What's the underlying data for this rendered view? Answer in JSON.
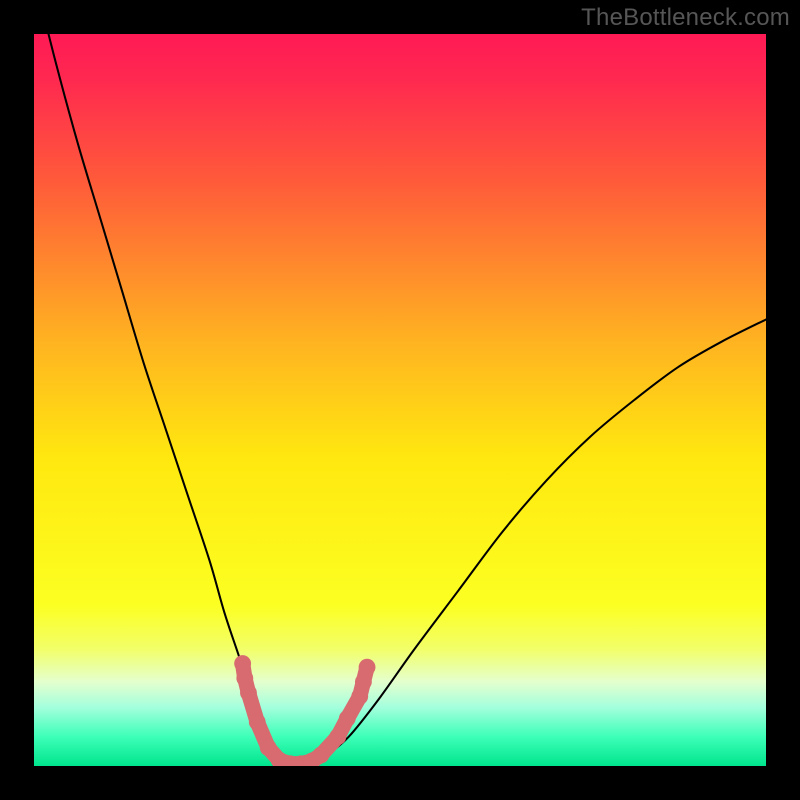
{
  "watermark": {
    "text": "TheBottleneck.com"
  },
  "chart_data": {
    "type": "line",
    "title": "",
    "xlabel": "",
    "ylabel": "",
    "xlim": [
      0,
      100
    ],
    "ylim": [
      0,
      100
    ],
    "background_gradient": {
      "stops": [
        {
          "pos": 0.0,
          "color": "#ff1a55"
        },
        {
          "pos": 0.06,
          "color": "#ff2850"
        },
        {
          "pos": 0.2,
          "color": "#ff5a3a"
        },
        {
          "pos": 0.42,
          "color": "#ffb321"
        },
        {
          "pos": 0.58,
          "color": "#ffe80f"
        },
        {
          "pos": 0.78,
          "color": "#fcff22"
        },
        {
          "pos": 0.84,
          "color": "#f2ff68"
        },
        {
          "pos": 0.885,
          "color": "#e4ffce"
        },
        {
          "pos": 0.92,
          "color": "#a3ffdd"
        },
        {
          "pos": 0.96,
          "color": "#3dffb8"
        },
        {
          "pos": 1.0,
          "color": "#00e58d"
        }
      ]
    },
    "series": [
      {
        "name": "bottleneck-curve",
        "color": "#000000",
        "x": [
          0,
          3,
          6,
          9,
          12,
          15,
          18,
          21,
          24,
          26,
          28,
          30,
          31.5,
          33,
          34.5,
          36,
          38,
          40,
          43,
          47,
          52,
          58,
          64,
          70,
          76,
          82,
          88,
          94,
          100
        ],
        "y": [
          108,
          96,
          85,
          75,
          65,
          55,
          46,
          37,
          28,
          21,
          15,
          9,
          5,
          2,
          0.5,
          0,
          0.5,
          1.5,
          4,
          9,
          16,
          24,
          32,
          39,
          45,
          50,
          54.5,
          58,
          61
        ]
      }
    ],
    "highlight": {
      "name": "optimal-markers",
      "color": "#d86b6f",
      "points": [
        {
          "x": 28.5,
          "y": 14
        },
        {
          "x": 28.8,
          "y": 12
        },
        {
          "x": 29.3,
          "y": 10
        },
        {
          "x": 30.5,
          "y": 6
        },
        {
          "x": 32.0,
          "y": 2.5
        },
        {
          "x": 33.5,
          "y": 0.8
        },
        {
          "x": 35.0,
          "y": 0.3
        },
        {
          "x": 36.5,
          "y": 0.3
        },
        {
          "x": 38.0,
          "y": 0.7
        },
        {
          "x": 39.2,
          "y": 1.5
        },
        {
          "x": 41.5,
          "y": 4
        },
        {
          "x": 42.8,
          "y": 6.5
        },
        {
          "x": 44.5,
          "y": 9.5
        },
        {
          "x": 45.0,
          "y": 11.5
        },
        {
          "x": 45.5,
          "y": 13.5
        }
      ]
    }
  }
}
